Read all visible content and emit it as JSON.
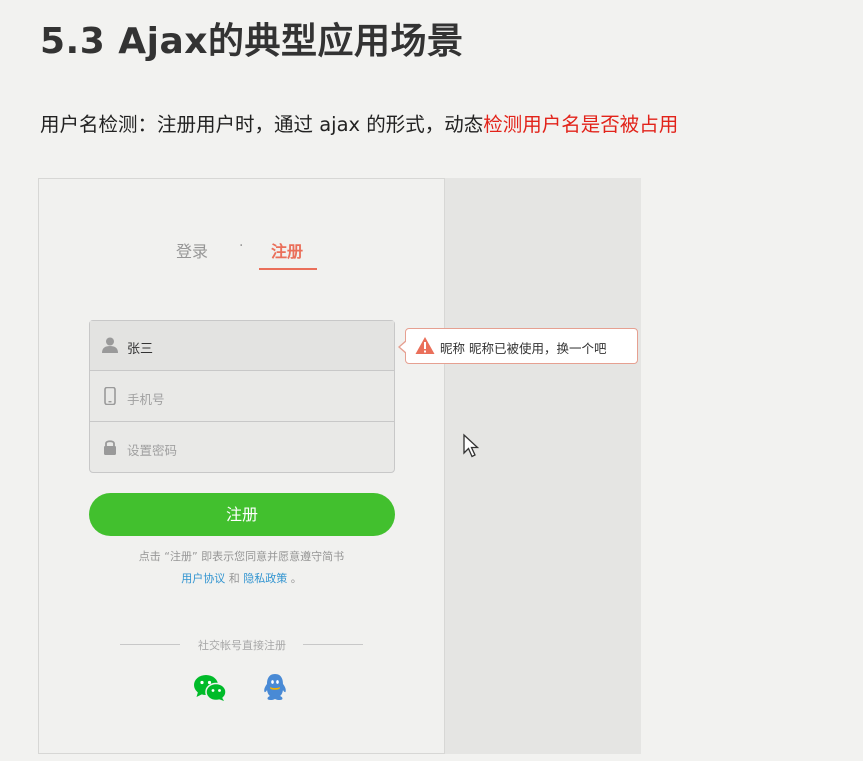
{
  "heading": "5.3 Ajax的典型应用场景",
  "description": {
    "prefix": "用户名检测：注册用户时，通过 ajax 的形式，动态",
    "highlight": "检测用户名是否被占用"
  },
  "form": {
    "tabs": {
      "login": "登录",
      "separator": "·",
      "register": "注册"
    },
    "fields": {
      "nickname_value": "张三",
      "phone_placeholder": "手机号",
      "password_placeholder": "设置密码"
    },
    "tooltip": "昵称 昵称已被使用，换一个吧",
    "register_button": "注册",
    "agreement": {
      "line1": "点击 “注册” 即表示您同意并愿意遵守简书",
      "user_agreement": "用户协议",
      "and": " 和 ",
      "privacy_policy": "隐私政策",
      "end": " 。"
    },
    "social_title": "社交帐号直接注册"
  },
  "colors": {
    "accent": "#ea6f5a",
    "button": "#42c02e",
    "highlight_text": "#e2231a",
    "link": "#3194d0",
    "wechat": "#00bb29",
    "qq": "#498ad5"
  }
}
